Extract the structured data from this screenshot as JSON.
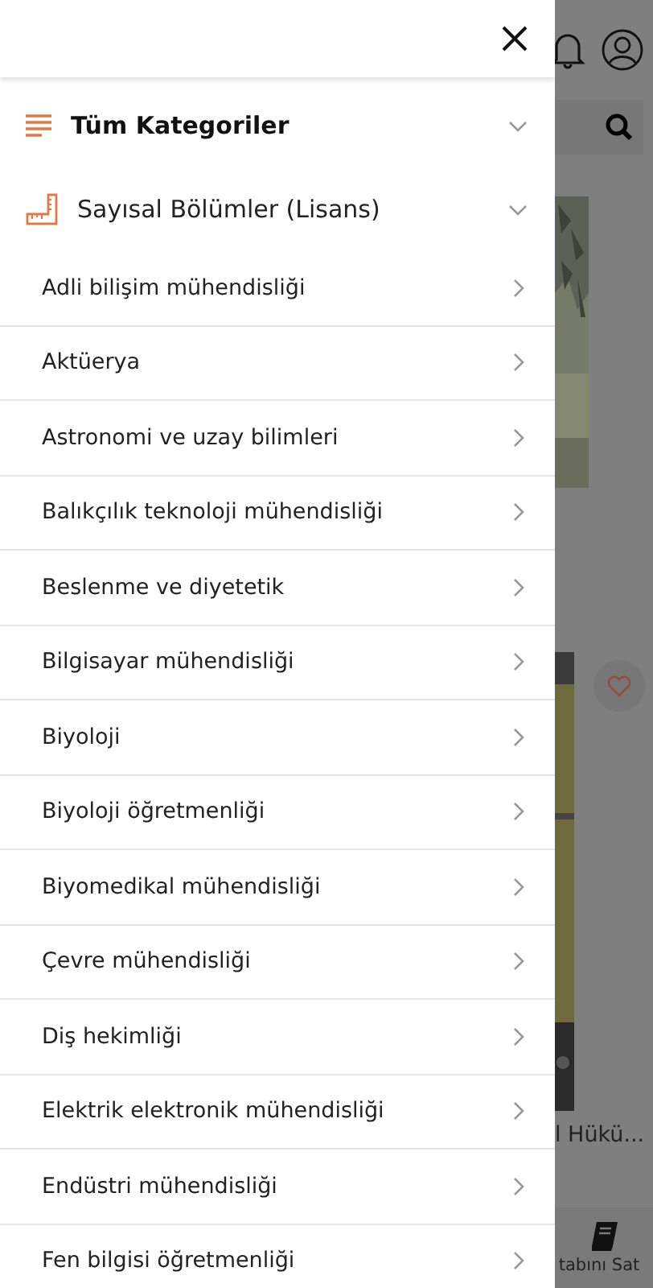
{
  "drawer": {
    "sections": [
      {
        "label": "Tüm Kategoriler",
        "kind": "all"
      },
      {
        "label": "Sayısal Bölümler (Lisans)",
        "kind": "ruler"
      }
    ],
    "items": [
      "Adli bilişim mühendisliği",
      "Aktüerya",
      "Astronomi ve uzay bilimleri",
      "Balıkçılık teknoloji mühendisliği",
      "Beslenme ve diyetetik",
      "Bilgisayar mühendisliği",
      "Biyoloji",
      "Biyoloji öğretmenliği",
      "Biyomedikal mühendisliği",
      "Çevre mühendisliği",
      "Diş hekimliği",
      "Elektrik elektronik mühendisliği",
      "Endüstri mühendisliği",
      "Fen bilgisi öğretmenliği"
    ]
  },
  "background": {
    "card_title": "l Hükü...",
    "nav_label": "tabını Sat"
  }
}
